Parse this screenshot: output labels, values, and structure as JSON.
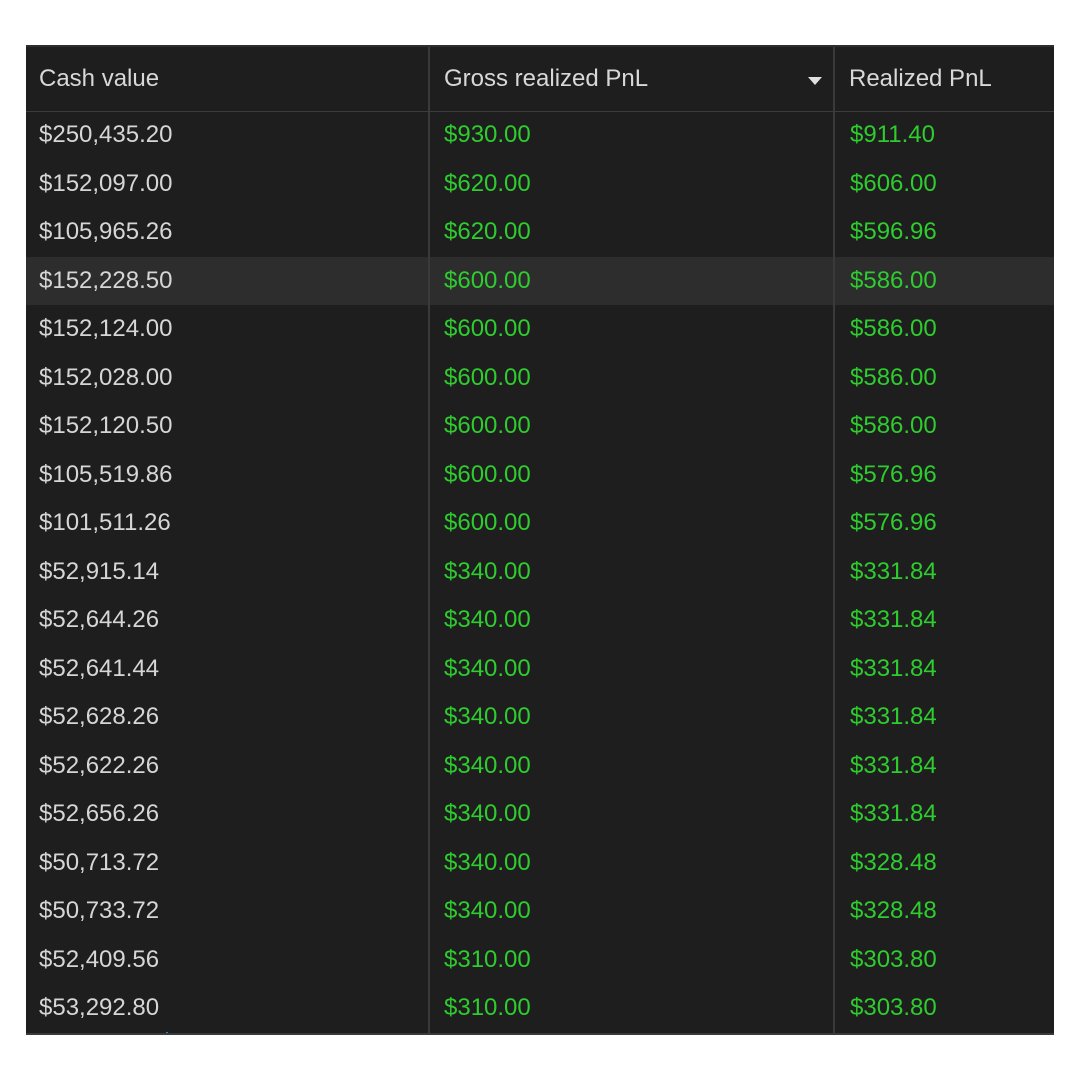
{
  "columns": {
    "cash_value": "Cash value",
    "gross_realized_pnl": "Gross realized PnL",
    "realized_pnl": "Realized PnL",
    "sort_icon": "chevron-down-icon"
  },
  "rows": [
    {
      "cash": "$250,435.20",
      "gross": "$930.00",
      "realized": "$911.40"
    },
    {
      "cash": "$152,097.00",
      "gross": "$620.00",
      "realized": "$606.00"
    },
    {
      "cash": "$105,965.26",
      "gross": "$620.00",
      "realized": "$596.96"
    },
    {
      "cash": "$152,228.50",
      "gross": "$600.00",
      "realized": "$586.00"
    },
    {
      "cash": "$152,124.00",
      "gross": "$600.00",
      "realized": "$586.00"
    },
    {
      "cash": "$152,028.00",
      "gross": "$600.00",
      "realized": "$586.00"
    },
    {
      "cash": "$152,120.50",
      "gross": "$600.00",
      "realized": "$586.00"
    },
    {
      "cash": "$105,519.86",
      "gross": "$600.00",
      "realized": "$576.96"
    },
    {
      "cash": "$101,511.26",
      "gross": "$600.00",
      "realized": "$576.96"
    },
    {
      "cash": "$52,915.14",
      "gross": "$340.00",
      "realized": "$331.84"
    },
    {
      "cash": "$52,644.26",
      "gross": "$340.00",
      "realized": "$331.84"
    },
    {
      "cash": "$52,641.44",
      "gross": "$340.00",
      "realized": "$331.84"
    },
    {
      "cash": "$52,628.26",
      "gross": "$340.00",
      "realized": "$331.84"
    },
    {
      "cash": "$52,622.26",
      "gross": "$340.00",
      "realized": "$331.84"
    },
    {
      "cash": "$52,656.26",
      "gross": "$340.00",
      "realized": "$331.84"
    },
    {
      "cash": "$50,713.72",
      "gross": "$340.00",
      "realized": "$328.48"
    },
    {
      "cash": "$50,733.72",
      "gross": "$340.00",
      "realized": "$328.48"
    },
    {
      "cash": "$52,409.56",
      "gross": "$310.00",
      "realized": "$303.80"
    },
    {
      "cash": "$53,292.80",
      "gross": "$310.00",
      "realized": "$303.80"
    }
  ],
  "highlighted_row_index": 3,
  "colors": {
    "background": "#1e1e1e",
    "header_text": "#d8d8d8",
    "cash_text": "#d6d6d6",
    "positive_pnl": "#2ecc2e",
    "highlight_row": "#2d2d2d",
    "grid_line": "#3a3a3a"
  }
}
